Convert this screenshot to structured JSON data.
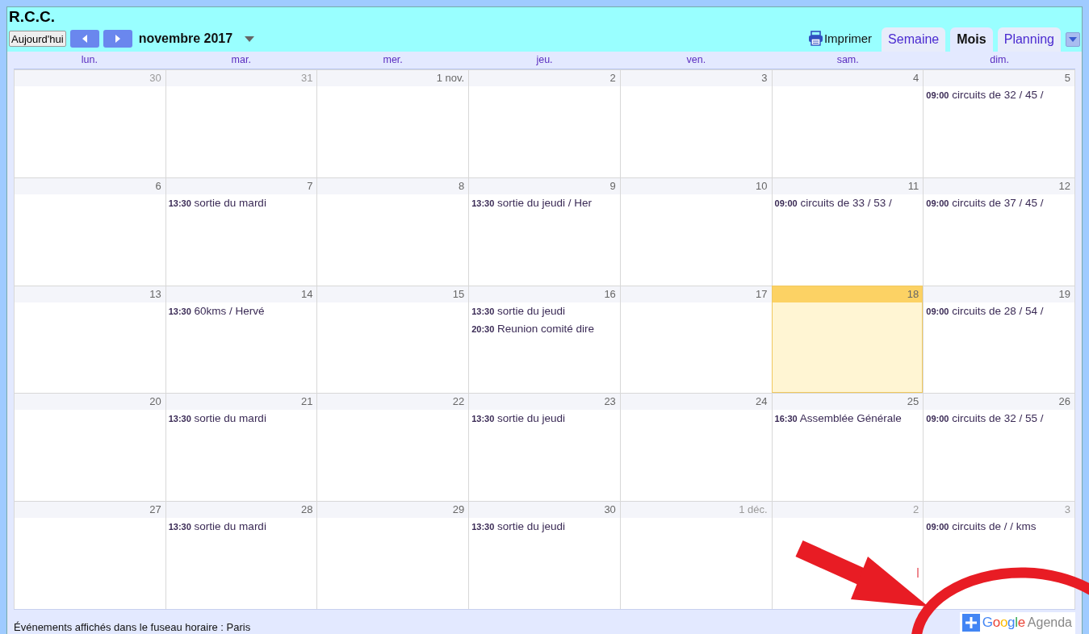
{
  "title": "R.C.C.",
  "toolbar": {
    "today_button": "Aujourd'hui",
    "month_label": "novembre 2017",
    "print_label": "Imprimer"
  },
  "tabs": [
    {
      "label": "Semaine",
      "selected": false
    },
    {
      "label": "Mois",
      "selected": true
    },
    {
      "label": "Planning",
      "selected": false
    }
  ],
  "weekdays": [
    "lun.",
    "mar.",
    "mer.",
    "jeu.",
    "ven.",
    "sam.",
    "dim."
  ],
  "weeks": [
    [
      {
        "date": "30",
        "other_month": true,
        "today": false
      },
      {
        "date": "31",
        "other_month": true,
        "today": false
      },
      {
        "date": "1 nov.",
        "other_month": false,
        "today": false
      },
      {
        "date": "2",
        "other_month": false,
        "today": false
      },
      {
        "date": "3",
        "other_month": false,
        "today": false
      },
      {
        "date": "4",
        "other_month": false,
        "today": false
      },
      {
        "date": "5",
        "other_month": false,
        "today": false,
        "events": [
          {
            "time": "09:00",
            "title": "circuits de 32 / 45 /"
          }
        ]
      }
    ],
    [
      {
        "date": "6",
        "other_month": false,
        "today": false
      },
      {
        "date": "7",
        "other_month": false,
        "today": false,
        "events": [
          {
            "time": "13:30",
            "title": "sortie du mardi"
          }
        ]
      },
      {
        "date": "8",
        "other_month": false,
        "today": false
      },
      {
        "date": "9",
        "other_month": false,
        "today": false,
        "events": [
          {
            "time": "13:30",
            "title": "sortie du jeudi / Her"
          }
        ]
      },
      {
        "date": "10",
        "other_month": false,
        "today": false
      },
      {
        "date": "11",
        "other_month": false,
        "today": false,
        "events": [
          {
            "time": "09:00",
            "title": "circuits de 33 / 53 /"
          }
        ]
      },
      {
        "date": "12",
        "other_month": false,
        "today": false,
        "events": [
          {
            "time": "09:00",
            "title": "circuits de 37 / 45 /"
          }
        ]
      }
    ],
    [
      {
        "date": "13",
        "other_month": false,
        "today": false
      },
      {
        "date": "14",
        "other_month": false,
        "today": false,
        "events": [
          {
            "time": "13:30",
            "title": "60kms / Hervé"
          }
        ]
      },
      {
        "date": "15",
        "other_month": false,
        "today": false
      },
      {
        "date": "16",
        "other_month": false,
        "today": false,
        "events": [
          {
            "time": "13:30",
            "title": "sortie du jeudi"
          },
          {
            "time": "20:30",
            "title": "Reunion comité dire"
          }
        ]
      },
      {
        "date": "17",
        "other_month": false,
        "today": false
      },
      {
        "date": "18",
        "other_month": false,
        "today": true
      },
      {
        "date": "19",
        "other_month": false,
        "today": false,
        "events": [
          {
            "time": "09:00",
            "title": "circuits de 28 / 54 /"
          }
        ]
      }
    ],
    [
      {
        "date": "20",
        "other_month": false,
        "today": false
      },
      {
        "date": "21",
        "other_month": false,
        "today": false,
        "events": [
          {
            "time": "13:30",
            "title": "sortie du mardi"
          }
        ]
      },
      {
        "date": "22",
        "other_month": false,
        "today": false
      },
      {
        "date": "23",
        "other_month": false,
        "today": false,
        "events": [
          {
            "time": "13:30",
            "title": "sortie du jeudi"
          }
        ]
      },
      {
        "date": "24",
        "other_month": false,
        "today": false
      },
      {
        "date": "25",
        "other_month": false,
        "today": false,
        "events": [
          {
            "time": "16:30",
            "title": "Assemblée Générale"
          }
        ]
      },
      {
        "date": "26",
        "other_month": false,
        "today": false,
        "events": [
          {
            "time": "09:00",
            "title": "circuits de 32 / 55 /"
          }
        ]
      }
    ],
    [
      {
        "date": "27",
        "other_month": false,
        "today": false
      },
      {
        "date": "28",
        "other_month": false,
        "today": false,
        "events": [
          {
            "time": "13:30",
            "title": "sortie du mardi"
          }
        ]
      },
      {
        "date": "29",
        "other_month": false,
        "today": false
      },
      {
        "date": "30",
        "other_month": false,
        "today": false,
        "events": [
          {
            "time": "13:30",
            "title": "sortie du jeudi"
          }
        ]
      },
      {
        "date": "1 déc.",
        "other_month": true,
        "today": false
      },
      {
        "date": "2",
        "other_month": true,
        "today": false
      },
      {
        "date": "3",
        "other_month": true,
        "today": false,
        "events": [
          {
            "time": "09:00",
            "title": "circuits de / / kms"
          }
        ]
      }
    ]
  ],
  "footer": {
    "timezone_note": "Événements affichés dans le fuseau horaire : Paris",
    "badge_brand": "Google",
    "badge_product": "Agenda"
  }
}
